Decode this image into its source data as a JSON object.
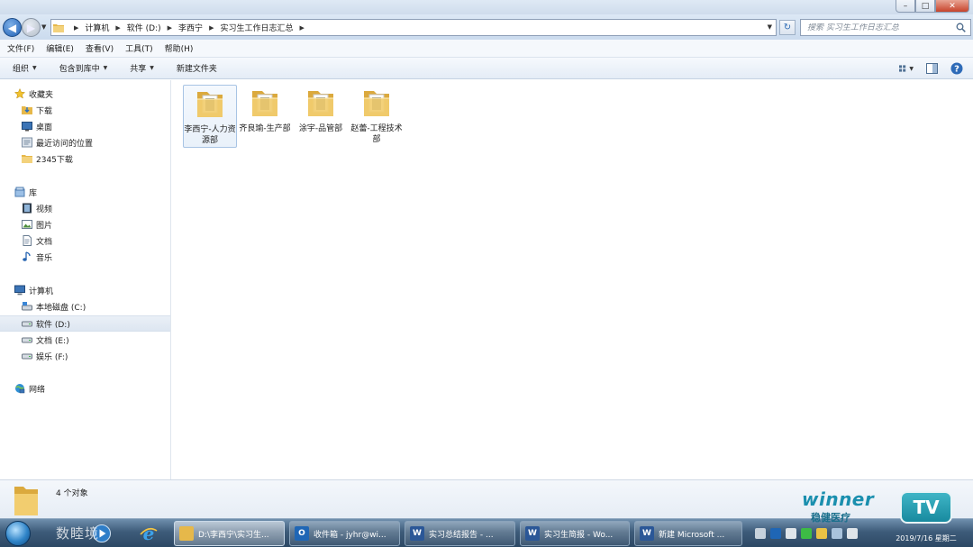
{
  "address": {
    "crumbs": [
      "计算机",
      "软件 (D:)",
      "李西宁",
      "实习生工作日志汇总"
    ]
  },
  "search": {
    "placeholder": "搜索 实习生工作日志汇总"
  },
  "menu": [
    "文件(F)",
    "编辑(E)",
    "查看(V)",
    "工具(T)",
    "帮助(H)"
  ],
  "toolbar": {
    "organize": "组织",
    "include_library": "包含到库中",
    "share": "共享",
    "new_folder": "新建文件夹"
  },
  "nav": {
    "favorites": "收藏夹",
    "downloads": "下载",
    "desktop": "桌面",
    "recent": "最近访问的位置",
    "dl2345": "2345下载",
    "libraries": "库",
    "videos": "视频",
    "pictures": "图片",
    "documents": "文档",
    "music": "音乐",
    "computer": "计算机",
    "drive_c": "本地磁盘 (C:)",
    "drive_d": "软件 (D:)",
    "drive_e": "文档 (E:)",
    "drive_f": "娱乐 (F:)",
    "network": "网络"
  },
  "folders": [
    {
      "label": "李西宁-人力资源部"
    },
    {
      "label": "齐良瑜-生产部"
    },
    {
      "label": "涂宇-品管部"
    },
    {
      "label": "赵蕾-工程技术部"
    }
  ],
  "status": {
    "count": "4 个对象"
  },
  "taskbar": {
    "tasks": [
      {
        "label": "D:\\李西宁\\实习生..."
      },
      {
        "label": "收件箱 - jyhr@wi..."
      },
      {
        "label": "实习总结报告 - ..."
      },
      {
        "label": "实习生简报 - Wo..."
      },
      {
        "label": "新建 Microsoft ..."
      }
    ],
    "clock_date": "2019/7/16 星期二"
  },
  "watermark": {
    "left": "数睦境",
    "winner": "winner",
    "winner_cn": "稳健医疗",
    "tv": "TV"
  },
  "colors": {
    "accent": "#1e5fb4",
    "folder": "#f0c75e",
    "taskbar": "#3e5c7a"
  }
}
